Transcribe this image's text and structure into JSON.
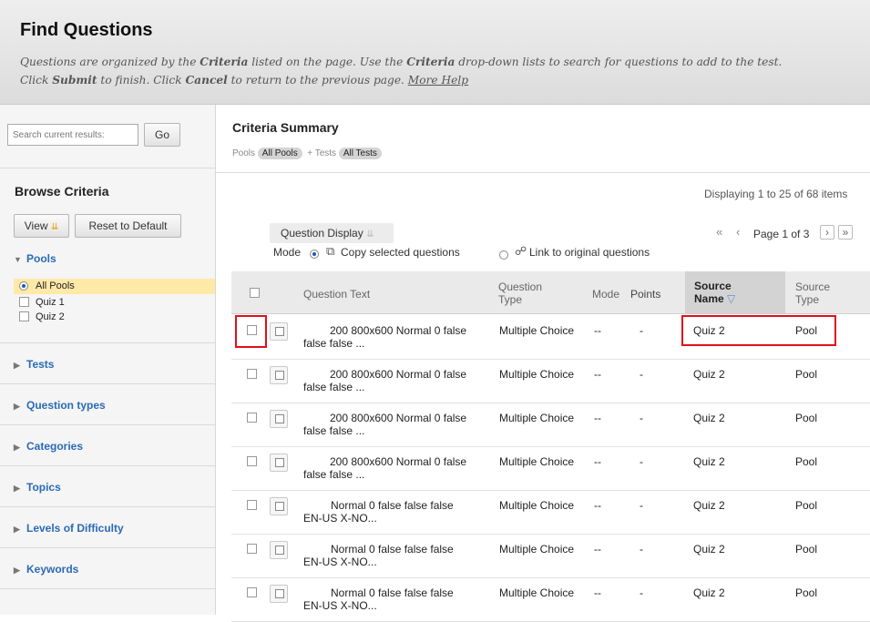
{
  "header": {
    "title": "Find Questions",
    "desc1_a": "Questions are organized by the ",
    "desc1_b": "Criteria",
    "desc1_c": " listed on the page. Use the ",
    "desc1_d": "Criteria",
    "desc1_e": " drop-down lists to search for questions to add to the test.",
    "desc2_a": "Click ",
    "desc2_b": "Submit",
    "desc2_c": " to finish. Click ",
    "desc2_d": "Cancel",
    "desc2_e": " to return to the previous page. ",
    "help_link": "More Help"
  },
  "sidebar": {
    "search_placeholder": "Search current results:",
    "go_label": "Go",
    "browse_title": "Browse Criteria",
    "view_label": "View",
    "reset_label": "Reset to Default",
    "pools_label": "Pools",
    "pool_items": [
      "All Pools",
      "Quiz 1",
      "Quiz 2"
    ],
    "categories": [
      "Tests",
      "Question types",
      "Categories",
      "Topics",
      "Levels of Difficulty",
      "Keywords"
    ]
  },
  "criteria": {
    "title": "Criteria Summary",
    "pools_label": "Pools",
    "pools_value": "All Pools",
    "tests_label": "+ Tests",
    "tests_value": "All Tests"
  },
  "results": {
    "displaying": "Displaying 1 to 25 of 68 items",
    "page_label": "Page 1 of 3",
    "question_display_label": "Question Display",
    "mode_label": "Mode",
    "copy_label": "Copy selected questions",
    "link_label": "Link to original questions"
  },
  "table": {
    "headers": {
      "question_text": "Question Text",
      "question_type_1": "Question",
      "question_type_2": "Type",
      "mode": "Mode",
      "points": "Points",
      "source_name_1": "Source",
      "source_name_2": "Name",
      "source_type_1": "Source",
      "source_type_2": "Type"
    },
    "rows": [
      {
        "text1": "200 800x600 Normal 0 false",
        "text2": "false false ...",
        "type": "Multiple Choice",
        "mode": "--",
        "points": "-",
        "source_name": "Quiz 2",
        "source_type": "Pool"
      },
      {
        "text1": "200 800x600 Normal 0 false",
        "text2": "false false ...",
        "type": "Multiple Choice",
        "mode": "--",
        "points": "-",
        "source_name": "Quiz 2",
        "source_type": "Pool"
      },
      {
        "text1": "200 800x600 Normal 0 false",
        "text2": "false false ...",
        "type": "Multiple Choice",
        "mode": "--",
        "points": "-",
        "source_name": "Quiz 2",
        "source_type": "Pool"
      },
      {
        "text1": "200 800x600 Normal 0 false",
        "text2": "false false ...",
        "type": "Multiple Choice",
        "mode": "--",
        "points": "-",
        "source_name": "Quiz 2",
        "source_type": "Pool"
      },
      {
        "text1": "Normal 0 false false false",
        "text2": "EN-US X-NO...",
        "type": "Multiple Choice",
        "mode": "--",
        "points": "-",
        "source_name": "Quiz 2",
        "source_type": "Pool"
      },
      {
        "text1": "Normal 0 false false false",
        "text2": "EN-US X-NO...",
        "type": "Multiple Choice",
        "mode": "--",
        "points": "-",
        "source_name": "Quiz 2",
        "source_type": "Pool"
      },
      {
        "text1": "Normal 0 false false false",
        "text2": "EN-US X-NO...",
        "type": "Multiple Choice",
        "mode": "--",
        "points": "-",
        "source_name": "Quiz 2",
        "source_type": "Pool"
      }
    ]
  },
  "colors": {
    "link": "#2a6ab8",
    "highlight": "#e0101a",
    "selected_pool": "#ffe9a8"
  }
}
